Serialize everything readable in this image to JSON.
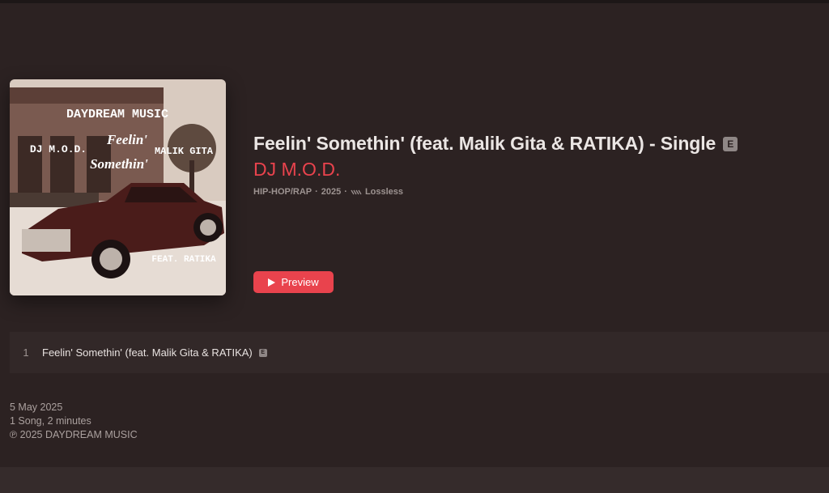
{
  "album": {
    "title": "Feelin' Somethin' (feat. Malik Gita & RATIKA) - Single",
    "explicit_badge": "E",
    "artist": "DJ M.O.D.",
    "genre": "HIP-HOP/RAP",
    "year": "2025",
    "quality": "Lossless",
    "artwork": {
      "label_name": "DAYDREAM MUSIC",
      "artist_text": "DJ M.O.D.",
      "title_line1": "Feelin'",
      "title_line2": "Somethin'",
      "feature_text": "MALIK GITA",
      "feat_text": "FEAT. RATIKA"
    }
  },
  "actions": {
    "preview_label": "Preview"
  },
  "tracks": [
    {
      "number": "1",
      "title": "Feelin' Somethin' (feat. Malik Gita & RATIKA)",
      "explicit": "E"
    }
  ],
  "footer": {
    "release_date": "5 May 2025",
    "summary": "1 Song, 2 minutes",
    "copyright": "℗ 2025 DAYDREAM MUSIC"
  },
  "colors": {
    "background": "#2c2222",
    "accent": "#e9434d",
    "row_bg": "#322828"
  }
}
